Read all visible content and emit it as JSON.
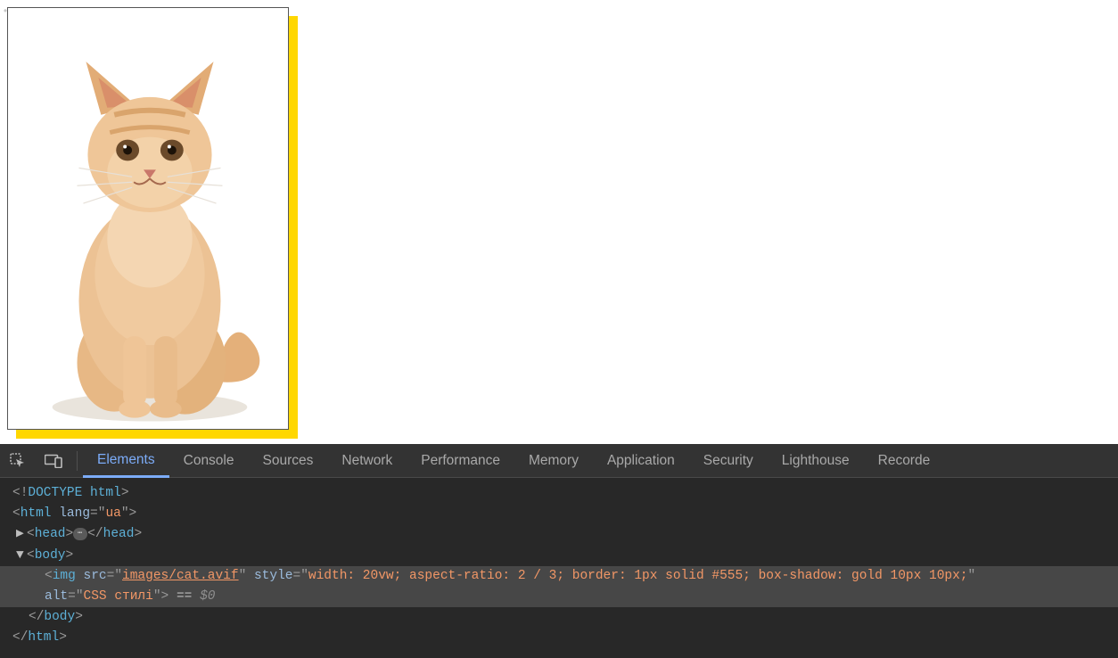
{
  "devtools": {
    "tabs": [
      "Elements",
      "Console",
      "Sources",
      "Network",
      "Performance",
      "Memory",
      "Application",
      "Security",
      "Lighthouse",
      "Recorde"
    ],
    "active_tab_index": 0
  },
  "dom": {
    "doctype_open": "<!",
    "doctype_name": "DOCTYPE ",
    "doctype_rest": "html",
    "doctype_close": ">",
    "html_tag": "html",
    "html_lang_attr": "lang",
    "html_lang_val": "ua",
    "head_tag": "head",
    "body_tag": "body",
    "img_tag": "img",
    "img_src_attr": "src",
    "img_src_val": "images/cat.avif",
    "img_style_attr": "style",
    "img_style_val": "width: 20vw; aspect-ratio: 2 / 3; border: 1px solid #555; box-shadow: gold 10px 10px;",
    "img_alt_attr": "alt",
    "img_alt_val": "CSS стилі",
    "eq_dollar": " == ",
    "dollar": "$0"
  },
  "symbols": {
    "open_lt": "<",
    "close_gt": ">",
    "open_lt_slash": "</",
    "eq": "=",
    "q": "\"",
    "arrow_right": "▶",
    "arrow_down": "▼",
    "ellipsis": "⋯",
    "gutter_dots": "•••"
  }
}
